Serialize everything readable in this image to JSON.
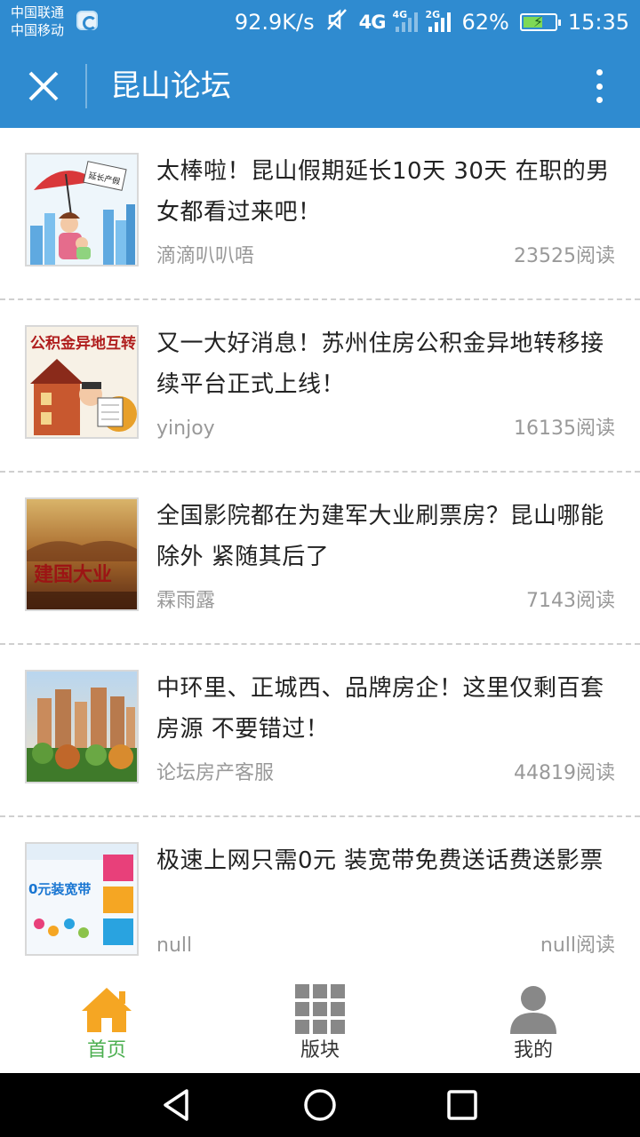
{
  "status_bar": {
    "carrier_1": "中国联通",
    "carrier_2": "中国移动",
    "speed": "92.9K/s",
    "network_1": "4G",
    "network_2": "2G",
    "battery": "62%",
    "battery_level": 0.62,
    "time": "15:35"
  },
  "app_bar": {
    "title": "昆山论坛",
    "close_icon": "close-icon",
    "menu_icon": "more-vertical-icon"
  },
  "feed": {
    "items": [
      {
        "title": "太棒啦！昆山假期延长10天 30天 在职的男女都看过来吧！",
        "author": "滴滴叭叭唔",
        "reads": "23525阅读",
        "thumb_text": "延长产假"
      },
      {
        "title": "又一大好消息！苏州住房公积金异地转移接续平台正式上线！",
        "author": "yinjoy",
        "reads": "16135阅读",
        "thumb_text": "公积金异地互转"
      },
      {
        "title": "全国影院都在为建军大业刷票房？昆山哪能除外 紧随其后了",
        "author": "霖雨露",
        "reads": "7143阅读",
        "thumb_text": "建国大业"
      },
      {
        "title": "中环里、正城西、品牌房企！这里仅剩百套房源 不要错过！",
        "author": "论坛房产客服",
        "reads": "44819阅读",
        "thumb_text": ""
      },
      {
        "title": "极速上网只需0元 装宽带免费送话费送影票",
        "author": "null",
        "reads": "null阅读",
        "thumb_text": "0元装宽带"
      }
    ]
  },
  "tabs": [
    {
      "label": "首页",
      "icon": "home-icon",
      "active": true
    },
    {
      "label": "版块",
      "icon": "grid-icon",
      "active": false
    },
    {
      "label": "我的",
      "icon": "user-icon",
      "active": false
    }
  ],
  "colors": {
    "primary": "#2f8bd0",
    "active_tab": "#4caf50",
    "home_icon": "#f5a623",
    "inactive_icon": "#888888"
  }
}
